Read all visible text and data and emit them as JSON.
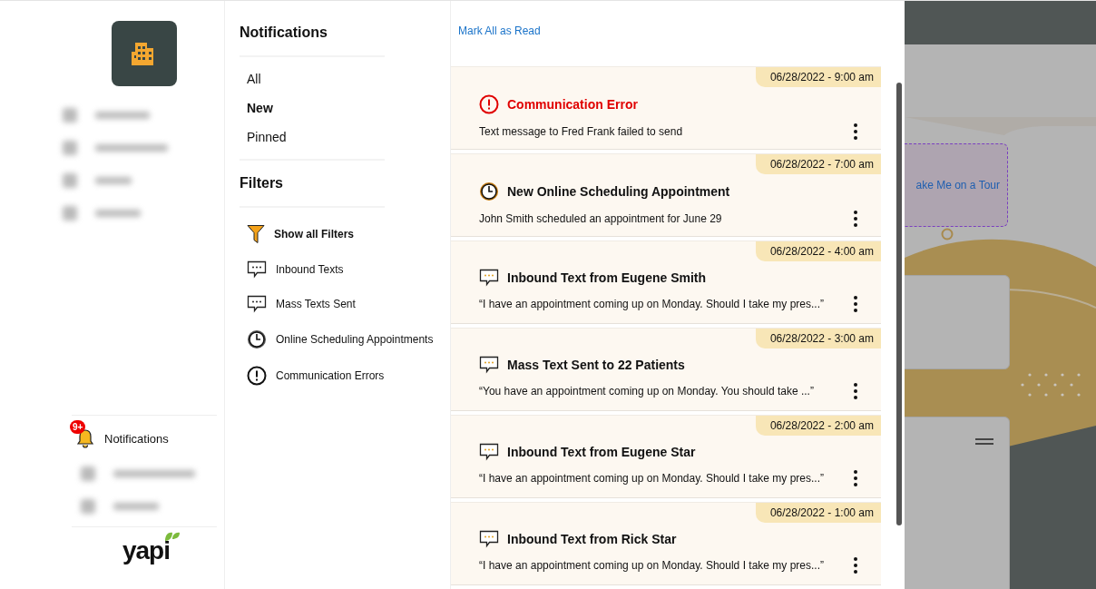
{
  "sidebar": {
    "notifications": {
      "label": "Notifications",
      "badge": "9+"
    },
    "logo": "yapi"
  },
  "panel": {
    "title": "Notifications",
    "views": [
      {
        "label": "All",
        "selected": false
      },
      {
        "label": "New",
        "selected": true
      },
      {
        "label": "Pinned",
        "selected": false
      }
    ],
    "filters_title": "Filters",
    "filters": [
      {
        "label": "Show all Filters",
        "kind": "funnel",
        "selected": true
      },
      {
        "label": "Inbound Texts",
        "kind": "text",
        "selected": false
      },
      {
        "label": "Mass Texts Sent",
        "kind": "text",
        "selected": false
      },
      {
        "label": "Online Scheduling Appointments",
        "kind": "clock",
        "selected": false
      },
      {
        "label": "Communication Errors",
        "kind": "error",
        "selected": false
      }
    ]
  },
  "list": {
    "mark_all": "Mark All as Read",
    "notifications": [
      {
        "kind": "error",
        "time": "06/28/2022 - 9:00 am",
        "title": "Communication Error",
        "message": "Text message to Fred Frank failed to send"
      },
      {
        "kind": "clock",
        "time": "06/28/2022 - 7:00 am",
        "title": "New Online Scheduling Appointment",
        "message": "John Smith scheduled an appointment for June 29"
      },
      {
        "kind": "text",
        "time": "06/28/2022 - 4:00 am",
        "title": "Inbound Text from Eugene Smith",
        "message": "“I have an appointment coming up on Monday. Should I take my pres...”"
      },
      {
        "kind": "text",
        "time": "06/28/2022 - 3:00 am",
        "title": "Mass Text Sent to 22 Patients",
        "message": "“You have an appointment coming up on Monday.  You should take ...”"
      },
      {
        "kind": "text",
        "time": "06/28/2022 - 2:00 am",
        "title": "Inbound Text from Eugene Star",
        "message": "“I have an appointment coming up on Monday. Should I take my pres...”"
      },
      {
        "kind": "text",
        "time": "06/28/2022 - 1:00 am",
        "title": "Inbound Text from Rick Star",
        "message": "“I have an appointment coming up on Monday. Should I take my pres...”"
      }
    ]
  },
  "background": {
    "tour_button": "ake Me on a Tour"
  }
}
